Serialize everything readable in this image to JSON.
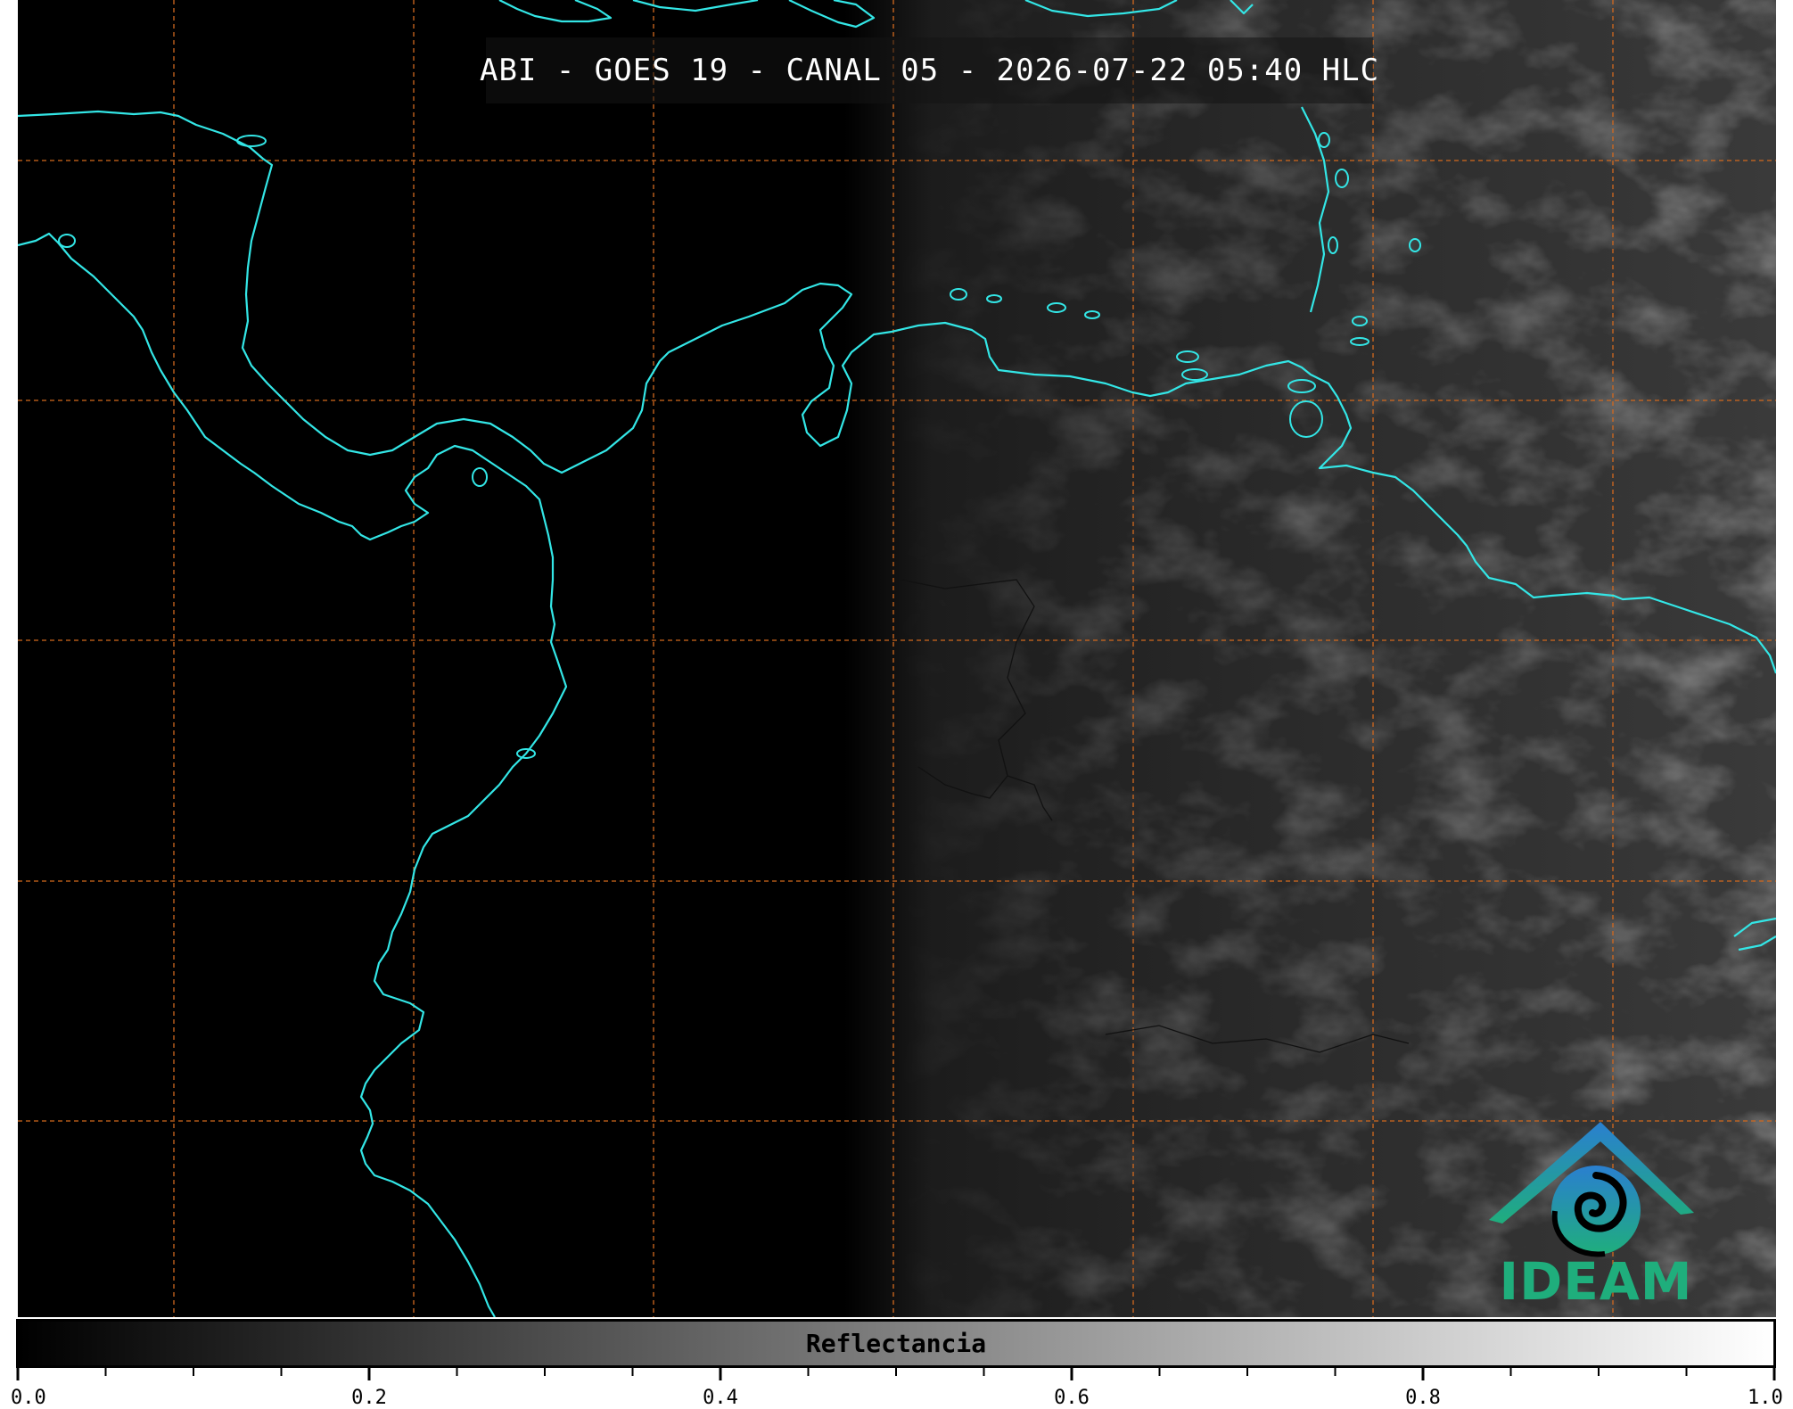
{
  "title": "ABI - GOES 19 - CANAL 05 - 2026-07-22 05:40 HLC",
  "logo": {
    "text": "IDEAM",
    "icon": "ideam-mountain-swirl-logo"
  },
  "colorbar": {
    "label": "Reflectancia",
    "ticks": [
      "0.0",
      "0.2",
      "0.4",
      "0.6",
      "0.8",
      "1.0"
    ],
    "range": [
      0.0,
      1.0
    ],
    "colormap": [
      "#000000",
      "#ffffff"
    ]
  },
  "map": {
    "coastline_color": "#33e6e6",
    "grid_color": "#d2691e",
    "grid_style": "dashed",
    "day_night_terminator": "visible"
  }
}
